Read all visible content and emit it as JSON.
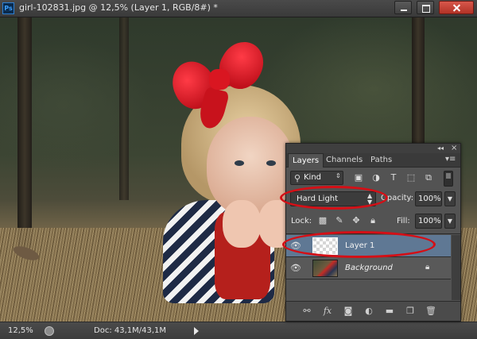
{
  "window": {
    "app_logo": "Ps",
    "title": "girl-102831.jpg @ 12,5% (Layer 1, RGB/8#) *"
  },
  "statusbar": {
    "zoom": "12,5%",
    "doc_info": "Doc: 43,1M/43,1M"
  },
  "layers_panel": {
    "tabs": [
      "Layers",
      "Channels",
      "Paths"
    ],
    "active_tab": "Layers",
    "filter": {
      "label": "Kind"
    },
    "blend_mode": "Hard Light",
    "opacity_label": "Opacity:",
    "opacity_value": "100%",
    "lock_label": "Lock:",
    "fill_label": "Fill:",
    "fill_value": "100%",
    "layers": [
      {
        "name": "Layer 1",
        "selected": true,
        "visible": true,
        "thumbnail": "transparent-checker"
      },
      {
        "name": "Background",
        "selected": false,
        "visible": true,
        "locked": true,
        "thumbnail": "photo"
      }
    ],
    "footer_icons": [
      "link-icon",
      "fx-icon",
      "mask-icon",
      "adjustment-icon",
      "folder-icon",
      "new-layer-icon",
      "trash-icon"
    ]
  },
  "colors": {
    "annotation": "#d40f16",
    "selected_layer": "#5f7894",
    "panel_bg": "#535353"
  }
}
